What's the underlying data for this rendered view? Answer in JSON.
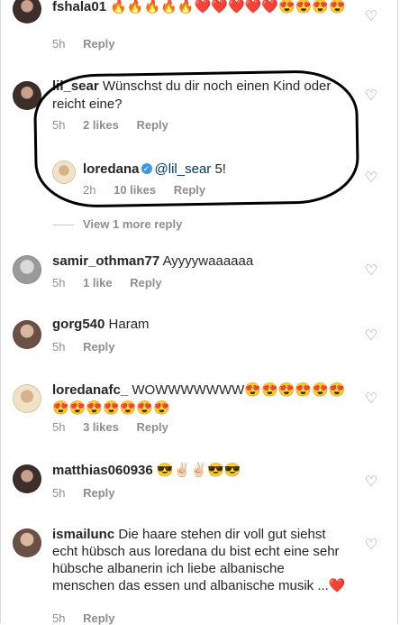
{
  "comments": [
    {
      "user": "fshala01",
      "text": "🔥🔥🔥🔥🔥❤️❤️❤️❤️❤️😍😍😍😍",
      "time": "5h",
      "likes": "",
      "reply": "Reply"
    },
    {
      "user": "lil_sear",
      "text": "Wünschst du dir noch einen Kind oder reicht eine?",
      "time": "5h",
      "likes": "2 likes",
      "reply": "Reply"
    },
    {
      "user": "loredana",
      "mention": "@lil_sear",
      "text": "5!",
      "time": "2h",
      "likes": "10 likes",
      "reply": "Reply"
    },
    {
      "user": "samir_othman77",
      "text": "Ayyyywaaaaaa",
      "time": "5h",
      "likes": "1 like",
      "reply": "Reply"
    },
    {
      "user": "gorg540",
      "text": "Haram",
      "time": "5h",
      "likes": "",
      "reply": "Reply"
    },
    {
      "user": "loredanafc_",
      "text": "WOWWWWWWW😍😍😍😍😍😍😍😍😍😍😍😍😍",
      "time": "5h",
      "likes": "3 likes",
      "reply": "Reply"
    },
    {
      "user": "matthias060936",
      "text": "😎✌🏻✌🏻😎😎",
      "time": "5h",
      "likes": "",
      "reply": "Reply"
    },
    {
      "user": "ismailunc",
      "text": "Die haare stehen dir voll gut siehst echt hübsch aus loredana du bist echt eine sehr hübsche albanerin ich liebe albanische menschen das essen und albanische musik ...❤️",
      "time": "5h",
      "likes": "",
      "reply": "Reply"
    }
  ],
  "view_more": "View 1 more reply"
}
